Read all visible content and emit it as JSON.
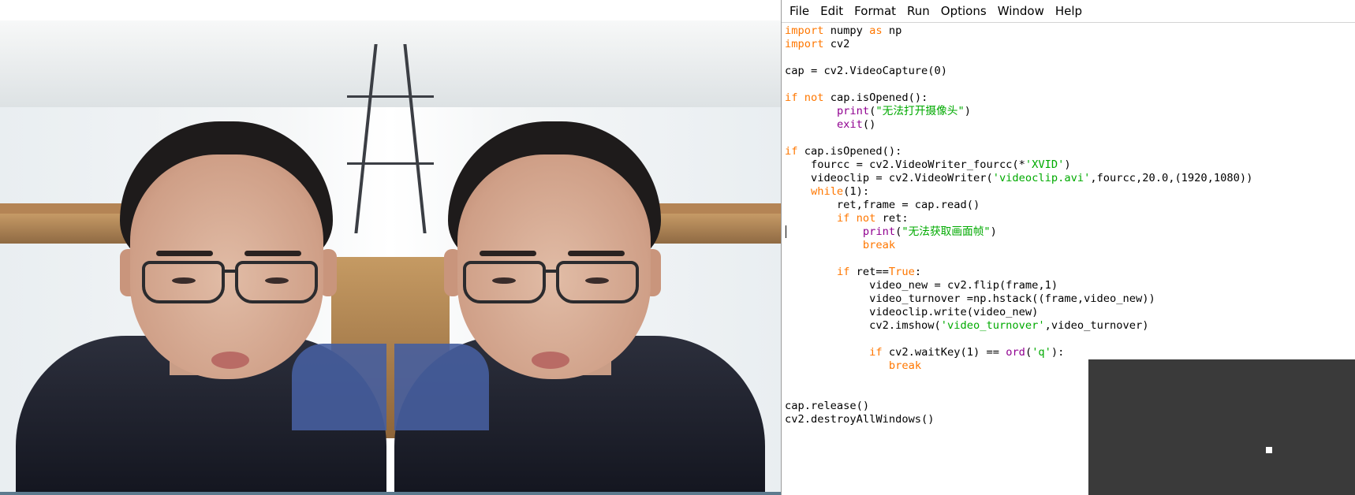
{
  "video_window": {
    "icons": [
      "webcam-frame",
      "mirrored-webcam-frame"
    ]
  },
  "editor": {
    "menu": [
      "File",
      "Edit",
      "Format",
      "Run",
      "Options",
      "Window",
      "Help"
    ],
    "code_lines": [
      [
        [
          "import",
          "kw"
        ],
        [
          " numpy ",
          ""
        ],
        [
          "as",
          "kw"
        ],
        [
          " np",
          ""
        ]
      ],
      [
        [
          "import",
          "kw"
        ],
        [
          " cv2",
          ""
        ]
      ],
      [],
      [
        [
          "cap = cv2.VideoCapture(0)",
          ""
        ]
      ],
      [],
      [
        [
          "if",
          "kw"
        ],
        [
          " ",
          ""
        ],
        [
          "not",
          "kw"
        ],
        [
          " cap.isOpened():",
          ""
        ]
      ],
      [
        [
          "        ",
          ""
        ],
        [
          "print",
          "bi"
        ],
        [
          "(",
          ""
        ],
        [
          "\"无法打开摄像头\"",
          "str"
        ],
        [
          ")",
          ""
        ]
      ],
      [
        [
          "        ",
          ""
        ],
        [
          "exit",
          "bi"
        ],
        [
          "()",
          ""
        ]
      ],
      [],
      [
        [
          "if",
          "kw"
        ],
        [
          " cap.isOpened():",
          ""
        ]
      ],
      [
        [
          "    fourcc = cv2.VideoWriter_fourcc(*",
          ""
        ],
        [
          "'XVID'",
          "str"
        ],
        [
          ")",
          ""
        ]
      ],
      [
        [
          "    videoclip = cv2.VideoWriter(",
          ""
        ],
        [
          "'videoclip.avi'",
          "str"
        ],
        [
          ",fourcc,20.0,(1920,1080))",
          ""
        ]
      ],
      [
        [
          "    ",
          ""
        ],
        [
          "while",
          "kw"
        ],
        [
          "(1):",
          ""
        ]
      ],
      [
        [
          "        ret,frame = cap.read()",
          ""
        ]
      ],
      [
        [
          "        ",
          ""
        ],
        [
          "if",
          "kw"
        ],
        [
          " ",
          ""
        ],
        [
          "not",
          "kw"
        ],
        [
          " ret:",
          ""
        ]
      ],
      [
        [
          "            ",
          ""
        ],
        [
          "print",
          "bi"
        ],
        [
          "(",
          ""
        ],
        [
          "\"无法获取画面帧\"",
          "str"
        ],
        [
          ")",
          ""
        ]
      ],
      [
        [
          "            ",
          ""
        ],
        [
          "break",
          "kw"
        ]
      ],
      [],
      [
        [
          "        ",
          ""
        ],
        [
          "if",
          "kw"
        ],
        [
          " ret==",
          ""
        ],
        [
          "True",
          "kw"
        ],
        [
          ":",
          ""
        ]
      ],
      [
        [
          "             video_new = cv2.flip(frame,1)",
          ""
        ]
      ],
      [
        [
          "             video_turnover =np.hstack((frame,video_new))",
          ""
        ]
      ],
      [
        [
          "             videoclip.write(video_new)",
          ""
        ]
      ],
      [
        [
          "             cv2.imshow(",
          ""
        ],
        [
          "'video_turnover'",
          "str"
        ],
        [
          ",video_turnover)",
          ""
        ]
      ],
      [],
      [
        [
          "             ",
          ""
        ],
        [
          "if",
          "kw"
        ],
        [
          " cv2.waitKey(1) == ",
          ""
        ],
        [
          "ord",
          "bi"
        ],
        [
          "(",
          ""
        ],
        [
          "'q'",
          "str"
        ],
        [
          "):",
          ""
        ]
      ],
      [
        [
          "                ",
          ""
        ],
        [
          "break",
          "kw"
        ]
      ],
      [],
      [],
      [
        [
          "cap.release()",
          ""
        ]
      ],
      [
        [
          "cv2.destroyAllWindows()",
          ""
        ]
      ]
    ]
  },
  "colors": {
    "keyword": "#ff7700",
    "builtin": "#900090",
    "string": "#00aa00",
    "overlay": "#3a3a3a"
  }
}
